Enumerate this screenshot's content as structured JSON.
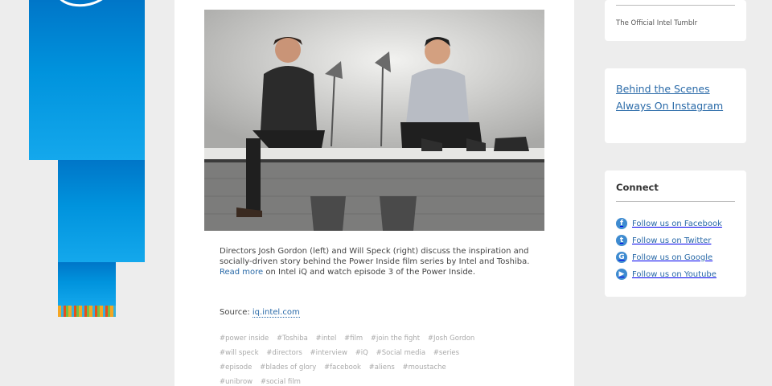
{
  "post": {
    "caption_text": "Directors Josh Gordon (left) and Will Speck (right) discuss the inspiration and socially-driven story behind the Power Inside film series by Intel and Toshiba.",
    "read_more_label": "Read more",
    "caption_tail": " on Intel iQ and watch episode 3 of the Power Inside.",
    "source_label": "Source: ",
    "source_link": "iq.intel.com",
    "tags": [
      "#power inside",
      "#Toshiba",
      "#intel",
      "#film",
      "#join the fight",
      "#Josh Gordon",
      "#will speck",
      "#directors",
      "#interview",
      "#iQ",
      "#Social media",
      "#series",
      "#episode",
      "#blades of glory",
      "#facebook",
      "#aliens",
      "#moustache",
      "#unibrow",
      "#social film"
    ]
  },
  "sidebar": {
    "tumblr_text": "The Official Intel Tumblr",
    "behind_link": "Behind the Scenes Always On Instagram",
    "connect_heading": "Connect",
    "social": [
      {
        "label": "Follow us on Facebook",
        "icon": "facebook-icon",
        "glyph": "f"
      },
      {
        "label": "Follow us on Twitter",
        "icon": "twitter-icon",
        "glyph": "t"
      },
      {
        "label": "Follow us on Google",
        "icon": "google-icon",
        "glyph": "G"
      },
      {
        "label": "Follow us on Youtube",
        "icon": "youtube-icon",
        "glyph": "▶"
      }
    ]
  },
  "colors": {
    "intel_blue": "#0071c5",
    "link": "#2a6aa8",
    "background": "#ededed"
  }
}
